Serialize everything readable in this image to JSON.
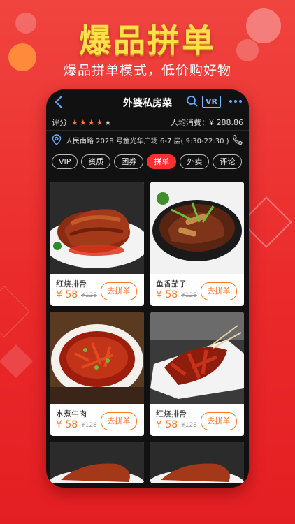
{
  "hero": {
    "title": "爆品拼单",
    "subtitle": "爆品拼单模式，低价购好物"
  },
  "colors": {
    "accent": "#ff2f2f",
    "price": "#ff7a1f",
    "title_gold": "#ffe04a"
  },
  "nav": {
    "title": "外婆私房菜",
    "vr_label": "VR",
    "back_icon": "chevron-left-icon",
    "search_icon": "search-icon",
    "more_icon": "more-icon"
  },
  "shop": {
    "rating_label": "评分",
    "rating": 4,
    "rating_max": 5,
    "avg_cost": "人均消费：¥ 288.86",
    "address": "人民南路 2028 号金光华广场 6-7 层( 9:30-22:30 )"
  },
  "tabs": [
    {
      "label": "VIP",
      "active": false
    },
    {
      "label": "资质",
      "active": false
    },
    {
      "label": "团券",
      "active": false
    },
    {
      "label": "拼单",
      "active": true
    },
    {
      "label": "外卖",
      "active": false
    },
    {
      "label": "评论",
      "active": false
    }
  ],
  "dishes": [
    {
      "name": "红烧排骨",
      "price": "¥ 58",
      "old_price": "¥128",
      "button": "去拼单"
    },
    {
      "name": "鱼香茄子",
      "price": "¥ 58",
      "old_price": "¥128",
      "button": "去拼单"
    },
    {
      "name": "水煮牛肉",
      "price": "¥ 58",
      "old_price": "¥128",
      "button": "去拼单"
    },
    {
      "name": "红烧排骨",
      "price": "¥ 58",
      "old_price": "¥128",
      "button": "去拼单"
    }
  ]
}
